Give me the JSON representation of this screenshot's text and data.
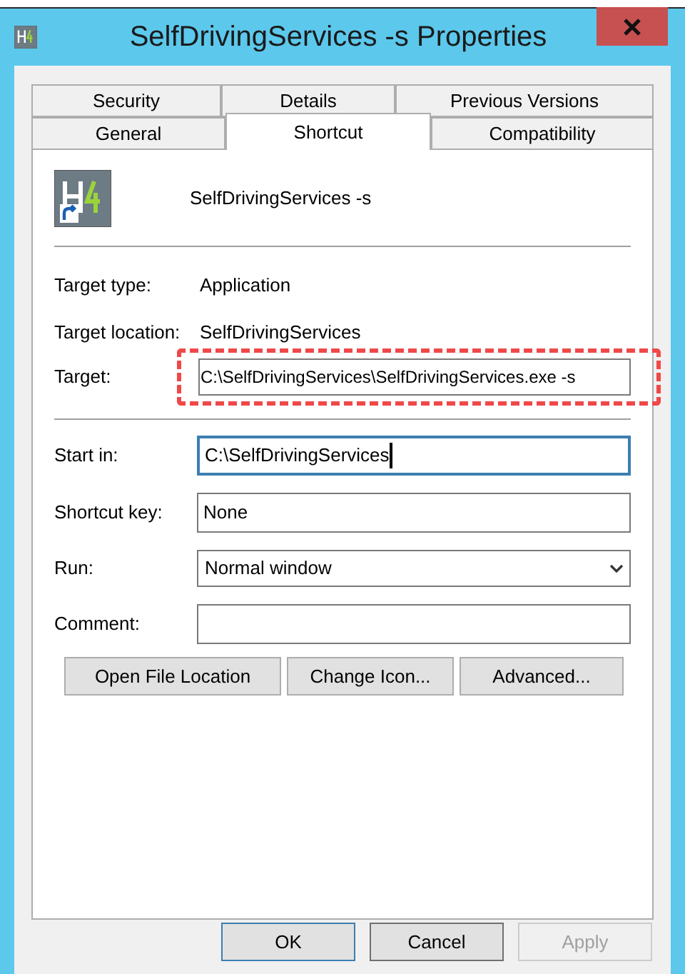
{
  "window": {
    "title": "SelfDrivingServices -s Properties"
  },
  "tab_rows": [
    [
      {
        "label": "Security",
        "selected": false
      },
      {
        "label": "Details",
        "selected": false
      },
      {
        "label": "Previous Versions",
        "selected": false
      }
    ],
    [
      {
        "label": "General",
        "selected": false
      },
      {
        "label": "Shortcut",
        "selected": true
      },
      {
        "label": "Compatibility",
        "selected": false
      }
    ]
  ],
  "shortcut_name": "SelfDrivingServices -s",
  "info": [
    {
      "label": "Target type:",
      "value": "Application"
    },
    {
      "label": "Target location:",
      "value": "SelfDrivingServices"
    }
  ],
  "target": {
    "label": "Target:",
    "value": "C:\\SelfDrivingServices\\SelfDrivingServices.exe -s",
    "highlighted": true
  },
  "fields": [
    {
      "kind": "text",
      "label": "Start in:",
      "value": "C:\\SelfDrivingServices",
      "focused": true
    },
    {
      "kind": "text",
      "label": "Shortcut key:",
      "value": "None",
      "focused": false
    },
    {
      "kind": "select",
      "label": "Run:",
      "value": "Normal window"
    },
    {
      "kind": "text",
      "label": "Comment:",
      "focused": false
    }
  ],
  "actions": [
    "Open File Location",
    "Change Icon...",
    "Advanced..."
  ],
  "buttons": [
    {
      "label": "OK",
      "default": true,
      "disabled": false
    },
    {
      "label": "Cancel",
      "default": false,
      "disabled": false
    },
    {
      "label": "Apply",
      "default": false,
      "disabled": true
    }
  ]
}
